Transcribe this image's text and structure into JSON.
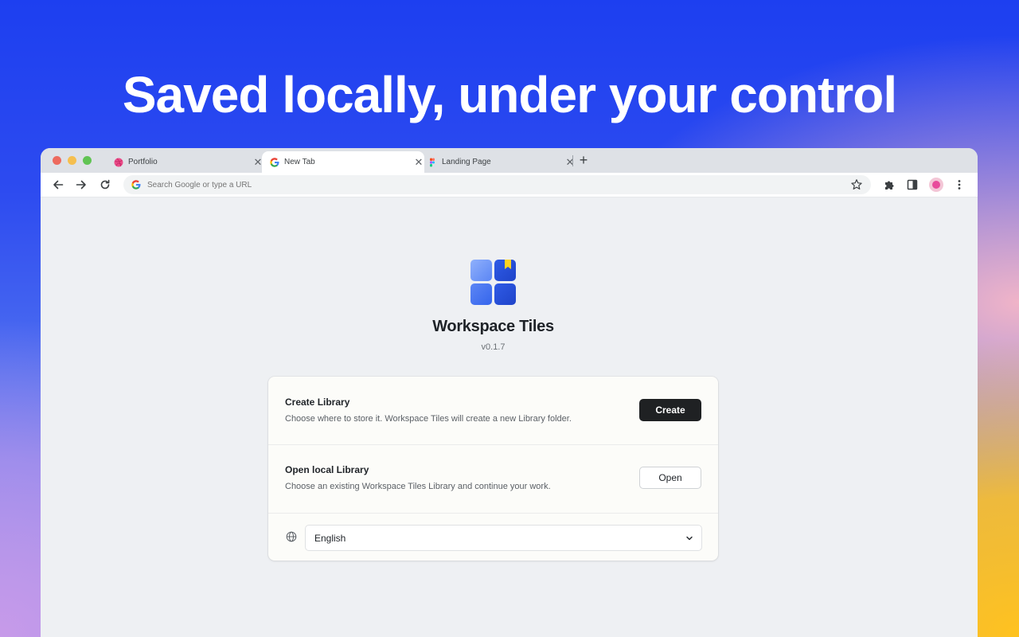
{
  "headline": "Saved locally, under your control",
  "browser": {
    "tabs": [
      {
        "label": "Portfolio",
        "favicon": "dribbble-icon",
        "active": false
      },
      {
        "label": "New Tab",
        "favicon": "google-icon",
        "active": true
      },
      {
        "label": "Landing Page",
        "favicon": "figma-icon",
        "active": false
      }
    ],
    "omnibox_placeholder": "Search Google or type a URL"
  },
  "app": {
    "title": "Workspace Tiles",
    "version": "v0.1.7",
    "accent_color": "#2f5be6"
  },
  "card": {
    "create": {
      "title": "Create Library",
      "description": "Choose where to store it. Workspace Tiles will create a new Library folder.",
      "button": "Create"
    },
    "open": {
      "title": "Open local Library",
      "description": "Choose an existing Workspace Tiles Library and continue your work.",
      "button": "Open"
    },
    "language": {
      "selected": "English"
    }
  }
}
